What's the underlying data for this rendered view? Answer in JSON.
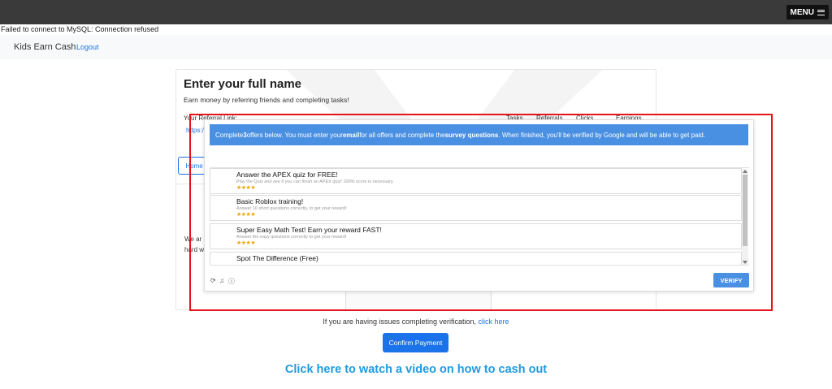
{
  "topbar": {
    "menu_label": "MENU"
  },
  "error_text": "Failed to connect to MySQL: Connection refused",
  "navbar": {
    "brand": "Kids Earn Cash",
    "logout": "Logout"
  },
  "card": {
    "title": "Enter your full name",
    "subtitle": "Earn money by referring friends and completing tasks!",
    "referral_label": "Your Referral Link:",
    "referral_link": "https:/",
    "stats_headers": [
      "Tasks",
      "Referrals",
      "Clicks",
      "Earnings"
    ],
    "home_button": "Home",
    "side_line_1": "We ar",
    "side_line_2": "hard w"
  },
  "modal": {
    "banner_pre": "Complete ",
    "banner_count": "3",
    "banner_mid1": " offers below. You must enter your ",
    "banner_email": "email",
    "banner_mid2": " for all offers and complete the ",
    "banner_survey": "survey questions",
    "banner_post": ". When finished, you'll be verified by Google and will be able to get paid.",
    "offers": [
      {
        "title": "Answer the APEX quiz for FREE!",
        "desc": "Play the Quiz and see if you can finish an APEX quiz! 100% score is necessary.",
        "stars": "★★★★"
      },
      {
        "title": "Basic Roblox training!",
        "desc": "Answer 10 short questions correctly, to get your reward!",
        "stars": "★★★★"
      },
      {
        "title": "Super Easy Math Test! Earn your reward FAST!",
        "desc": "Answer the easy questions correctly to get your reward!",
        "stars": "★★★★"
      },
      {
        "title": "Spot The Difference (Free)",
        "desc": "",
        "stars": ""
      }
    ],
    "verify_label": "VERIFY"
  },
  "issues_text": "If you are having issues completing verification,",
  "issues_link": "click here",
  "confirm_label": "Confirm Payment",
  "video_link": "Click here to watch a video on how to cash out",
  "colors": {
    "accent": "#1a73e8",
    "banner": "#4a90e2",
    "highlight": "#e3141c",
    "stars": "#f0a500"
  }
}
